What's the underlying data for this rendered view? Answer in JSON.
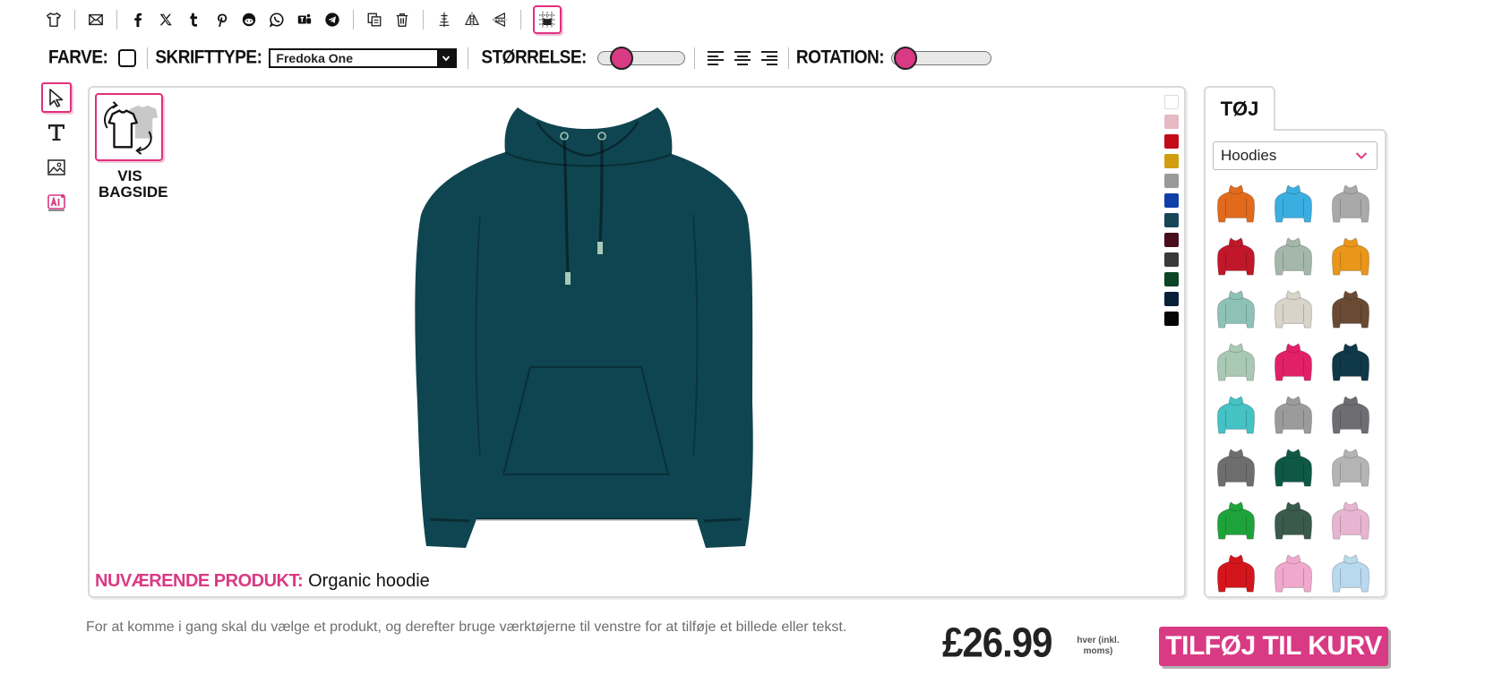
{
  "topbar": {
    "icons": [
      "tshirt-icon",
      "email-icon",
      "facebook-icon",
      "x-icon",
      "tumblr-icon",
      "pinterest-icon",
      "reddit-icon",
      "whatsapp-icon",
      "teams-icon",
      "telegram-icon",
      "copy-icon",
      "trash-icon",
      "center-align-icon",
      "flip-horizontal-icon",
      "flip-vertical-icon",
      "grid-toggle-icon"
    ]
  },
  "toolbar": {
    "color_label": "FARVE:",
    "font_label": "SKRIFTTYPE:",
    "font_value": "Fredoka One",
    "size_label": "STØRRELSE:",
    "size_level": 0.18,
    "rotation_label": "ROTATION:",
    "rotation_level": 0.02,
    "accent": "#d93a84"
  },
  "canvas": {
    "flip_label_1": "VIS",
    "flip_label_2": "BAGSIDE",
    "current_product_label": "NUVÆRENDE PRODUKT:",
    "current_product_value": "Organic hoodie",
    "product_color": "#0f4550",
    "swatches": [
      "#ffffff",
      "#e6b9c3",
      "#c40c18",
      "#d19e12",
      "#9a9a9a",
      "#0f3ea8",
      "#164758",
      "#4a0d1c",
      "#3a3a3a",
      "#0d4426",
      "#0a1f3a",
      "#050505"
    ]
  },
  "panel": {
    "tab_label": "TØJ",
    "category": "Hoodies",
    "products": [
      {
        "color": "#e26a1d"
      },
      {
        "color": "#3aaee0"
      },
      {
        "color": "#a9a9a9"
      },
      {
        "color": "#c0182a"
      },
      {
        "color": "#a4b7aa"
      },
      {
        "color": "#e9961a"
      },
      {
        "color": "#8fc2b6"
      },
      {
        "color": "#d9d4c9"
      },
      {
        "color": "#6a4a33"
      },
      {
        "color": "#a9c9b4"
      },
      {
        "color": "#e2206a"
      },
      {
        "color": "#0f3848"
      },
      {
        "color": "#44c2c4"
      },
      {
        "color": "#9b9b9b"
      },
      {
        "color": "#6d6d72"
      },
      {
        "color": "#6e6e6e"
      },
      {
        "color": "#0f5846"
      },
      {
        "color": "#b4b4b4"
      },
      {
        "color": "#1ea33a"
      },
      {
        "color": "#3a5a4c"
      },
      {
        "color": "#e7b5d2"
      },
      {
        "color": "#d4161c"
      },
      {
        "color": "#f0a8cc"
      },
      {
        "color": "#b8d9ee"
      }
    ]
  },
  "footer": {
    "hint": "For at komme i gang skal du vælge et produkt, og derefter bruge værktøjerne til venstre for at tilføje et billede eller tekst.",
    "price": "£26.99",
    "price_note": "hver (inkl. moms)",
    "add_to_cart": "TILFØJ TIL KURV"
  }
}
